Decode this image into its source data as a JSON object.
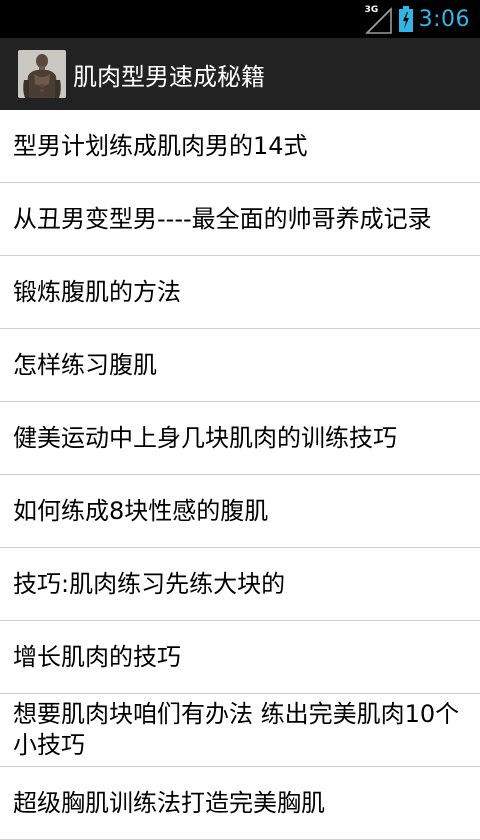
{
  "status_bar": {
    "network_type": "3G",
    "time": "3:06",
    "icons": [
      "signal-icon",
      "battery-icon"
    ]
  },
  "action_bar": {
    "icon": "app-icon-muscle-man",
    "title": "肌肉型男速成秘籍"
  },
  "articles": [
    {
      "title": "型男计划练成肌肉男的14式"
    },
    {
      "title": "从丑男变型男----最全面的帅哥养成记录"
    },
    {
      "title": "锻炼腹肌的方法"
    },
    {
      "title": "怎样练习腹肌"
    },
    {
      "title": "健美运动中上身几块肌肉的训练技巧"
    },
    {
      "title": "如何练成8块性感的腹肌"
    },
    {
      "title": "技巧:肌肉练习先练大块的"
    },
    {
      "title": "增长肌肉的技巧"
    },
    {
      "title": "想要肌肉块咱们有办法 练出完美肌肉10个小技巧"
    },
    {
      "title": "超级胸肌训练法打造完美胸肌"
    }
  ],
  "colors": {
    "status_bar_bg": "#000000",
    "clock": "#33b5e5",
    "action_bar_bg": "#222222",
    "list_bg": "#ffffff",
    "divider": "#cfcfcf"
  }
}
